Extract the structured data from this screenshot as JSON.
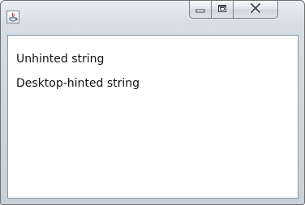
{
  "window": {
    "title": "",
    "icon": "java-icon",
    "controls": {
      "minimize_icon": "minimize-icon",
      "maximize_icon": "maximize-icon",
      "close_icon": "close-icon"
    }
  },
  "content": {
    "lines": [
      "Unhinted string",
      "Desktop-hinted string"
    ]
  },
  "colors": {
    "frame": "#d6dde5",
    "client_bg": "#ffffff",
    "text": "#111111"
  }
}
